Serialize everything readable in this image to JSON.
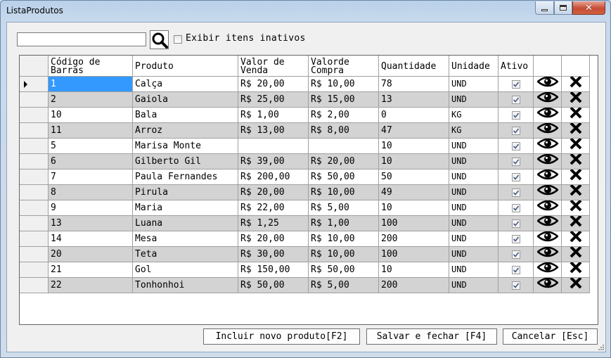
{
  "window": {
    "title": "ListaProdutos"
  },
  "toolbar": {
    "search_value": "",
    "inactive_label": "Exibir itens inativos"
  },
  "grid": {
    "headers": {
      "codigo_l1": "Código de",
      "codigo_l2": "Barras",
      "produto": "Produto",
      "venda_l1": "Valor de",
      "venda_l2": "Venda",
      "compra_l1": "Valorde",
      "compra_l2": "Compra",
      "quantidade": "Quantidade",
      "unidade": "Unidade",
      "ativo": "Ativo"
    },
    "rows": [
      {
        "codigo": "1",
        "produto": "Calça",
        "venda": "R$ 20,00",
        "compra": "R$ 10,00",
        "quantidade": "78",
        "unidade": "UND"
      },
      {
        "codigo": "2",
        "produto": "Gaiola",
        "venda": "R$ 25,00",
        "compra": "R$ 15,00",
        "quantidade": "13",
        "unidade": "UND"
      },
      {
        "codigo": "10",
        "produto": "Bala",
        "venda": "R$ 1,00",
        "compra": "R$ 2,00",
        "quantidade": "0",
        "unidade": "KG"
      },
      {
        "codigo": "11",
        "produto": "Arroz",
        "venda": "R$ 13,00",
        "compra": "R$ 8,00",
        "quantidade": "47",
        "unidade": "KG"
      },
      {
        "codigo": "5",
        "produto": "Marisa Monte",
        "venda": "",
        "compra": "",
        "quantidade": "10",
        "unidade": "UND"
      },
      {
        "codigo": "6",
        "produto": "Gilberto Gil",
        "venda": "R$ 39,00",
        "compra": "R$ 20,00",
        "quantidade": "10",
        "unidade": "UND"
      },
      {
        "codigo": "7",
        "produto": "Paula Fernandes",
        "venda": "R$ 200,00",
        "compra": "R$ 50,00",
        "quantidade": "50",
        "unidade": "UND"
      },
      {
        "codigo": "8",
        "produto": "Pirula",
        "venda": "R$ 20,00",
        "compra": "R$ 10,00",
        "quantidade": "49",
        "unidade": "UND"
      },
      {
        "codigo": "9",
        "produto": "Maria",
        "venda": "R$ 22,00",
        "compra": "R$ 5,00",
        "quantidade": "10",
        "unidade": "UND"
      },
      {
        "codigo": "13",
        "produto": "Luana",
        "venda": "R$ 1,25",
        "compra": "R$ 1,00",
        "quantidade": "100",
        "unidade": "UND"
      },
      {
        "codigo": "14",
        "produto": "Mesa",
        "venda": "R$ 20,00",
        "compra": "R$ 10,00",
        "quantidade": "200",
        "unidade": "UND"
      },
      {
        "codigo": "20",
        "produto": "Teta",
        "venda": "R$ 30,00",
        "compra": "R$ 10,00",
        "quantidade": "100",
        "unidade": "UND"
      },
      {
        "codigo": "21",
        "produto": "Gol",
        "venda": "R$ 150,00",
        "compra": "R$ 50,00",
        "quantidade": "10",
        "unidade": "UND"
      },
      {
        "codigo": "22",
        "produto": "Tonhonhoi",
        "venda": "R$ 50,00",
        "compra": "R$ 5,00",
        "quantidade": "200",
        "unidade": "UND"
      }
    ],
    "row_icons": {
      "view": "eye-icon",
      "delete": "x-icon",
      "active": "checkbox-checked"
    }
  },
  "buttons": {
    "add": "Incluir novo produto[F2]",
    "save": "Salvar e fechar [F4]",
    "cancel": "Cancelar [Esc]"
  },
  "colors": {
    "selection": "#3399ff",
    "alt_row": "#d3d3d3",
    "close_button": "#c74a34"
  }
}
